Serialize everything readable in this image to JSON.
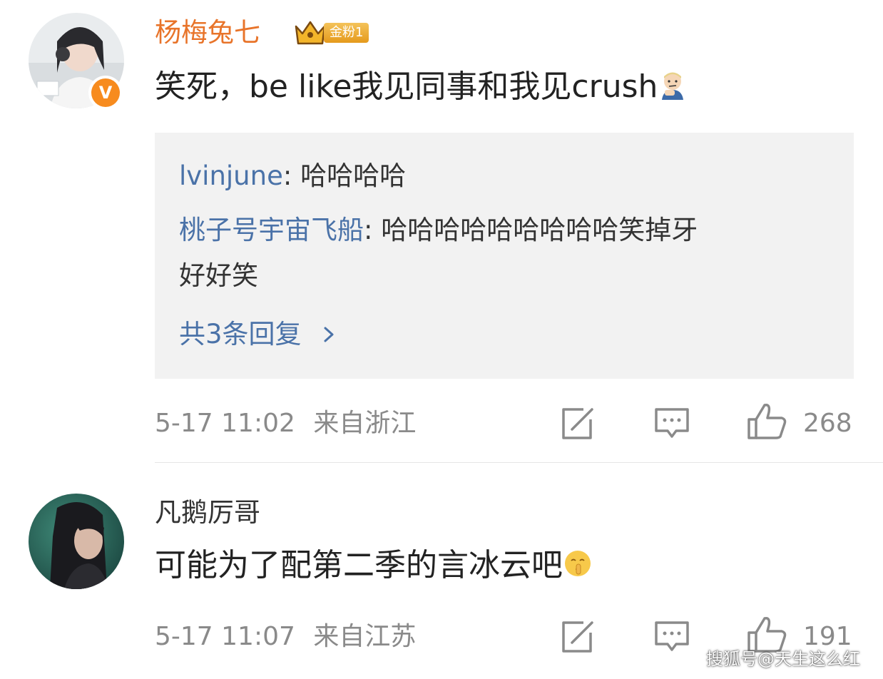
{
  "comments": [
    {
      "username": "杨梅兔七",
      "fan_badge": "金粉1",
      "verified_badge": "V",
      "content": "笑死，be like我见同事和我见crush",
      "content_emoji": "thinking-man-emoji",
      "replies": [
        {
          "user": "lvinjune",
          "sep": ": ",
          "text": "哈哈哈哈"
        },
        {
          "user": "桃子号宇宙飞船",
          "sep": ": ",
          "text": "哈哈哈哈哈哈哈哈哈笑掉牙",
          "text_cont": "好好笑"
        }
      ],
      "more_replies": "共3条回复",
      "timestamp": "5-17 11:02",
      "location": "来自浙江",
      "likes": "268"
    },
    {
      "username": "凡鹅厉哥",
      "content": "可能为了配第二季的言冰云吧",
      "content_emoji": "shush-face-emoji",
      "timestamp": "5-17 11:07",
      "location": "来自江苏",
      "likes": "191"
    }
  ],
  "watermark": "搜狐号@天生这么红",
  "colors": {
    "gold_username": "#e8742a",
    "reply_link": "#4a72a8",
    "meta_gray": "#8a8a8a",
    "reply_bg": "#f2f2f2",
    "verified_orange": "#f78b1e"
  }
}
